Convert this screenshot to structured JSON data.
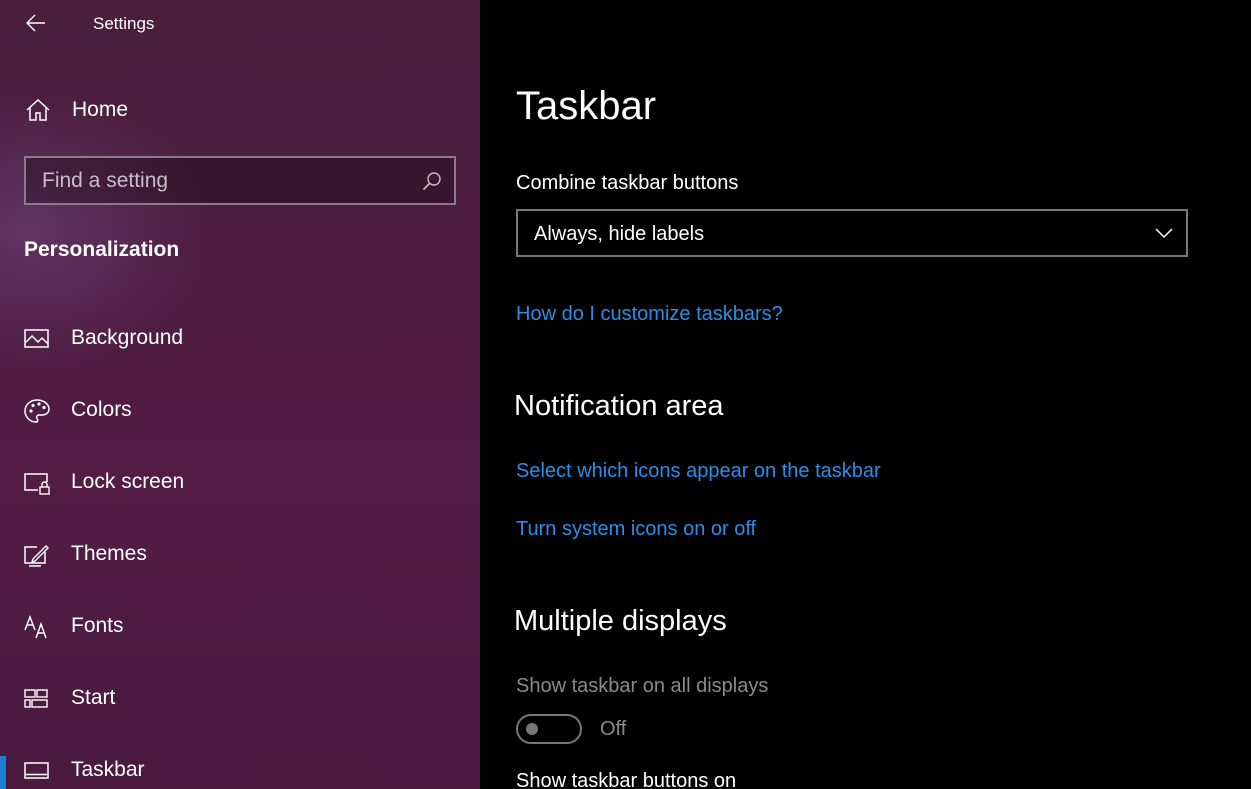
{
  "window": {
    "app_title": "Settings"
  },
  "sidebar": {
    "home_label": "Home",
    "search": {
      "placeholder": "Find a setting"
    },
    "section_title": "Personalization",
    "items": [
      {
        "label": "Background",
        "icon": "background-icon"
      },
      {
        "label": "Colors",
        "icon": "palette-icon"
      },
      {
        "label": "Lock screen",
        "icon": "lock-screen-icon"
      },
      {
        "label": "Themes",
        "icon": "themes-icon"
      },
      {
        "label": "Fonts",
        "icon": "fonts-icon"
      },
      {
        "label": "Start",
        "icon": "start-icon"
      },
      {
        "label": "Taskbar",
        "icon": "taskbar-icon",
        "active": true
      }
    ]
  },
  "main": {
    "title": "Taskbar",
    "combine": {
      "label": "Combine taskbar buttons",
      "selected": "Always, hide labels"
    },
    "help_link": "How do I customize taskbars?",
    "notification_area": {
      "heading": "Notification area",
      "links": [
        "Select which icons appear on the taskbar",
        "Turn system icons on or off"
      ]
    },
    "multiple_displays": {
      "heading": "Multiple displays",
      "show_all_label": "Show taskbar on all displays",
      "toggle_state": "Off",
      "buttons_on_label": "Show taskbar buttons on"
    }
  },
  "colors": {
    "accent": "#1b7fd6",
    "link": "#2a8ee6",
    "sidebar_bg": "#4d1d40",
    "main_bg": "#000000"
  }
}
